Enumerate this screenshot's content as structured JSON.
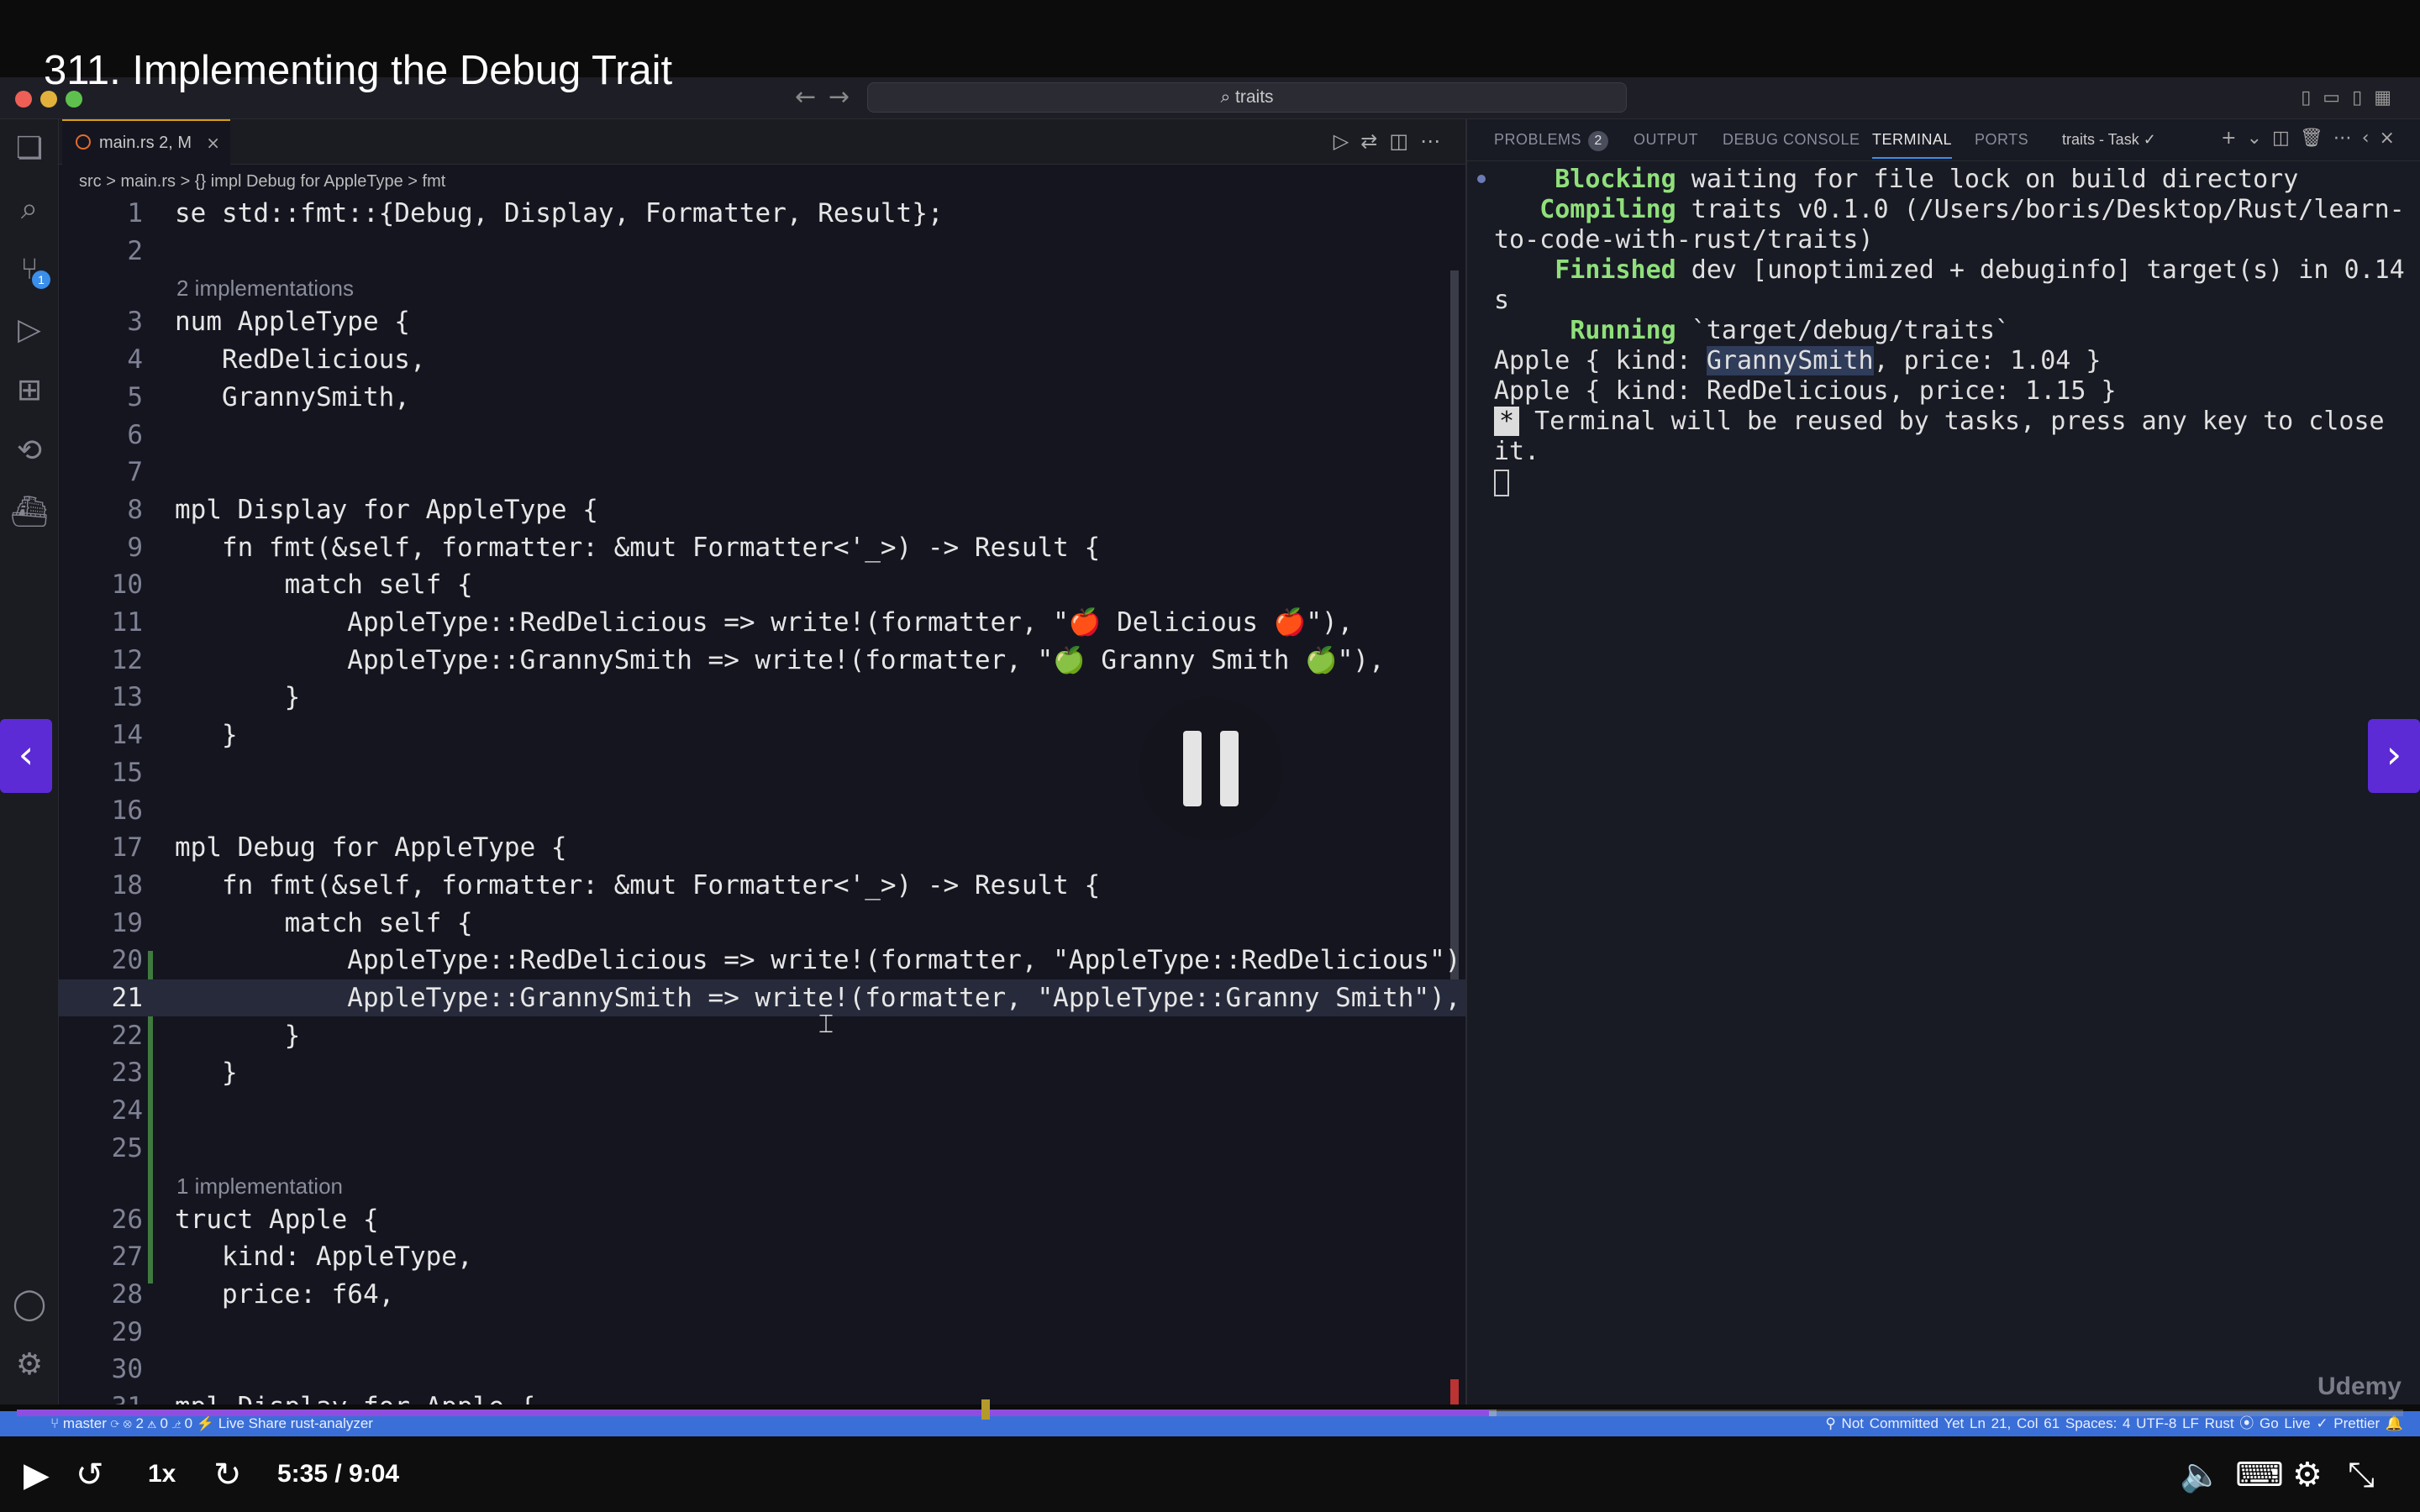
{
  "video": {
    "title": "311. Implementing the Debug Trait",
    "time": "5:35 / 9:04",
    "speed": "1x",
    "progress": 0.617,
    "buffered": 0.62,
    "watermark": "Udemy"
  },
  "window": {
    "search": "⌕ traits"
  },
  "editor": {
    "tab": {
      "label": "main.rs 2, M"
    },
    "breadcrumb": "src > main.rs > {} impl Debug for AppleType > fmt",
    "codelens": [
      {
        "text": "2 implementations"
      },
      {
        "text": "1 implementation"
      }
    ],
    "lines": [
      {
        "n": "1",
        "code": "se std::fmt::{Debug, Display, Formatter, Result};"
      },
      {
        "n": "2",
        "code": ""
      },
      {
        "n": "3",
        "code": "num AppleType {"
      },
      {
        "n": "4",
        "code": "   RedDelicious,"
      },
      {
        "n": "5",
        "code": "   GrannySmith,"
      },
      {
        "n": "6",
        "code": ""
      },
      {
        "n": "7",
        "code": ""
      },
      {
        "n": "8",
        "code": "mpl Display for AppleType {"
      },
      {
        "n": "9",
        "code": "   fn fmt(&self, formatter: &mut Formatter<'_>) -> Result {"
      },
      {
        "n": "10",
        "code": "       match self {"
      },
      {
        "n": "11",
        "code": "           AppleType::RedDelicious => write!(formatter, \"🍎 Delicious 🍎\"),"
      },
      {
        "n": "12",
        "code": "           AppleType::GrannySmith => write!(formatter, \"🍏 Granny Smith 🍏\"),"
      },
      {
        "n": "13",
        "code": "       }"
      },
      {
        "n": "14",
        "code": "   }"
      },
      {
        "n": "15",
        "code": ""
      },
      {
        "n": "16",
        "code": ""
      },
      {
        "n": "17",
        "code": "mpl Debug for AppleType {"
      },
      {
        "n": "18",
        "code": "   fn fmt(&self, formatter: &mut Formatter<'_>) -> Result {"
      },
      {
        "n": "19",
        "code": "       match self {"
      },
      {
        "n": "20",
        "code": "           AppleType::RedDelicious => write!(formatter, \"AppleType::RedDelicious\"),"
      },
      {
        "n": "21",
        "code": "           AppleType::GrannySmith => write!(formatter, \"AppleType::Granny Smith\"),"
      },
      {
        "n": "22",
        "code": "       }"
      },
      {
        "n": "23",
        "code": "   }"
      },
      {
        "n": "24",
        "code": ""
      },
      {
        "n": "25",
        "code": ""
      },
      {
        "n": "26",
        "code": "truct Apple {"
      },
      {
        "n": "27",
        "code": "   kind: AppleType,"
      },
      {
        "n": "28",
        "code": "   price: f64,"
      },
      {
        "n": "29",
        "code": ""
      },
      {
        "n": "30",
        "code": ""
      },
      {
        "n": "31",
        "code": "mpl Display for Apple {"
      }
    ],
    "current_line": "21"
  },
  "panel": {
    "tabs": {
      "problems": "PROBLEMS",
      "problems_count": "2",
      "output": "OUTPUT",
      "debug": "DEBUG CONSOLE",
      "terminal": "TERMINAL",
      "ports": "PORTS"
    },
    "task": "traits - Task ✓",
    "terminal": {
      "l1a": "    Blocking",
      "l1b": " waiting for file lock on build directory",
      "l2a": "   Compiling",
      "l2b": " traits v0.1.0 (/Users/boris/Desktop/Rust/learn-to-code-with-rust/traits)",
      "l3a": "    Finished",
      "l3b": " dev [unoptimized + debuginfo] target(s) in 0.14 s",
      "l4a": "     Running",
      "l4b": " `target/debug/traits`",
      "l5a": "Apple { kind: ",
      "l5b": "GrannySmith",
      "l5c": ", price: 1.04 }",
      "l6": "Apple { kind: RedDelicious, price: 1.15 }",
      "l7a": "*",
      "l7b": " Terminal will be reused by tasks, press any key to close it."
    }
  },
  "statusbar": {
    "left": "⑂ master  ⟳  ⊗ 2 ⚠ 0   ⎇ 0   ⚡ Live Share   rust-analyzer",
    "right": "⚲ Not Committed Yet   Ln 21, Col 61   Spaces: 4   UTF-8   LF   Rust   ⦿ Go Live   ✓ Prettier   🔔"
  },
  "icons": {
    "play": "play-icon",
    "rewind": "rewind-5s-icon",
    "forward": "forward-5s-icon",
    "volume": "volume-icon",
    "captions": "captions-icon",
    "settings": "settings-icon",
    "fullscreen": "exit-fullscreen-icon"
  }
}
